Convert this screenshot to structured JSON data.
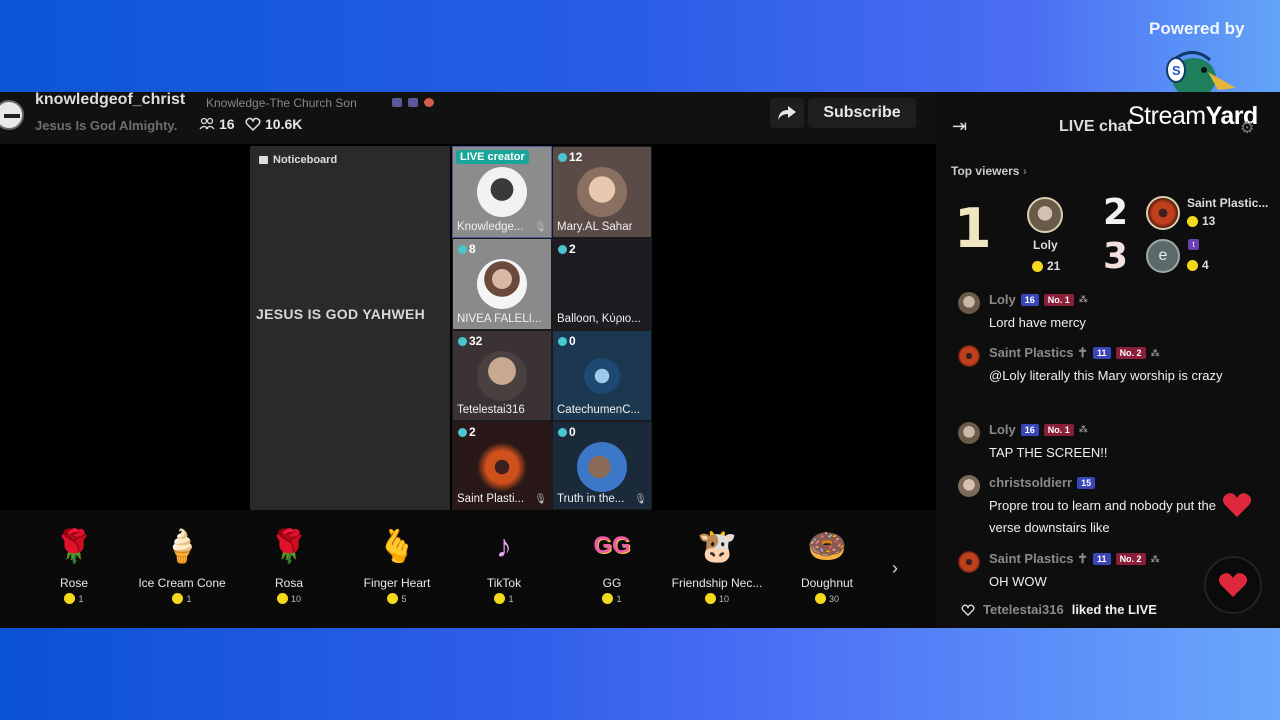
{
  "branding": {
    "powered_by": "Powered by",
    "logo_light": "Stream",
    "logo_bold": "Yard"
  },
  "header": {
    "channel_name": "knowledgeof_christ",
    "subtitle": "Knowledge-The Church Son",
    "description": "Jesus Is God Almighty.",
    "viewers": "16",
    "likes": "10.6K",
    "subscribe_label": "Subscribe"
  },
  "noticeboard": {
    "label": "Noticeboard",
    "text": "JESUS IS GOD YAHWEH"
  },
  "guests": [
    {
      "badge": "LIVE creator",
      "name": "Knowledge...",
      "muted": true
    },
    {
      "count": "12",
      "name": "Mary.AL Sahar"
    },
    {
      "count": "8",
      "name": "NIVEA FALELI..."
    },
    {
      "count": "2",
      "name": "Balloon, Κύριο..."
    },
    {
      "count": "32",
      "name": "Tetelestai316"
    },
    {
      "count": "0",
      "name": "CatechumenC..."
    },
    {
      "count": "2",
      "name": "Saint Plasti...",
      "muted": true
    },
    {
      "count": "0",
      "name": "Truth in the...",
      "muted": true
    }
  ],
  "gifts": [
    {
      "name": "Rose",
      "price": "1",
      "icon": "🌹"
    },
    {
      "name": "Ice Cream Cone",
      "price": "1",
      "icon": "🍦"
    },
    {
      "name": "Rosa",
      "price": "10",
      "icon": "🌹"
    },
    {
      "name": "Finger Heart",
      "price": "5",
      "icon": "🫰"
    },
    {
      "name": "TikTok",
      "price": "1",
      "icon": "♪"
    },
    {
      "name": "GG",
      "price": "1",
      "icon": "GG"
    },
    {
      "name": "Friendship Nec...",
      "price": "10",
      "icon": "🐮"
    },
    {
      "name": "Doughnut",
      "price": "30",
      "icon": "🍩"
    }
  ],
  "chat": {
    "title": "LIVE chat",
    "top_viewers_label": "Top viewers",
    "top_viewers": [
      {
        "rank": "1",
        "name": "Loly",
        "coins": "21"
      },
      {
        "rank": "2",
        "name": "Saint Plastic...",
        "coins": "13"
      },
      {
        "rank": "3",
        "name": "e",
        "coins": "4"
      }
    ],
    "messages": [
      {
        "user": "Loly",
        "level": "16",
        "rank_badge": "No. 1",
        "text": "Lord have mercy"
      },
      {
        "user": "Saint Plastics ✝",
        "level": "11",
        "rank_badge": "No. 2",
        "text": "@Loly literally this Mary worship is crazy"
      },
      {
        "user": "Loly",
        "level": "16",
        "rank_badge": "No. 1",
        "text": "TAP THE SCREEN!!"
      },
      {
        "user": "christsoldierr",
        "level": "15",
        "text": "Propre trou to learn and nobody put the verse downstairs like"
      },
      {
        "user": "Saint Plastics ✝",
        "level": "11",
        "rank_badge": "No. 2",
        "text": "OH WOW"
      }
    ],
    "liked_event": {
      "user": "Tetelestai316",
      "text": "liked the LIVE"
    }
  }
}
